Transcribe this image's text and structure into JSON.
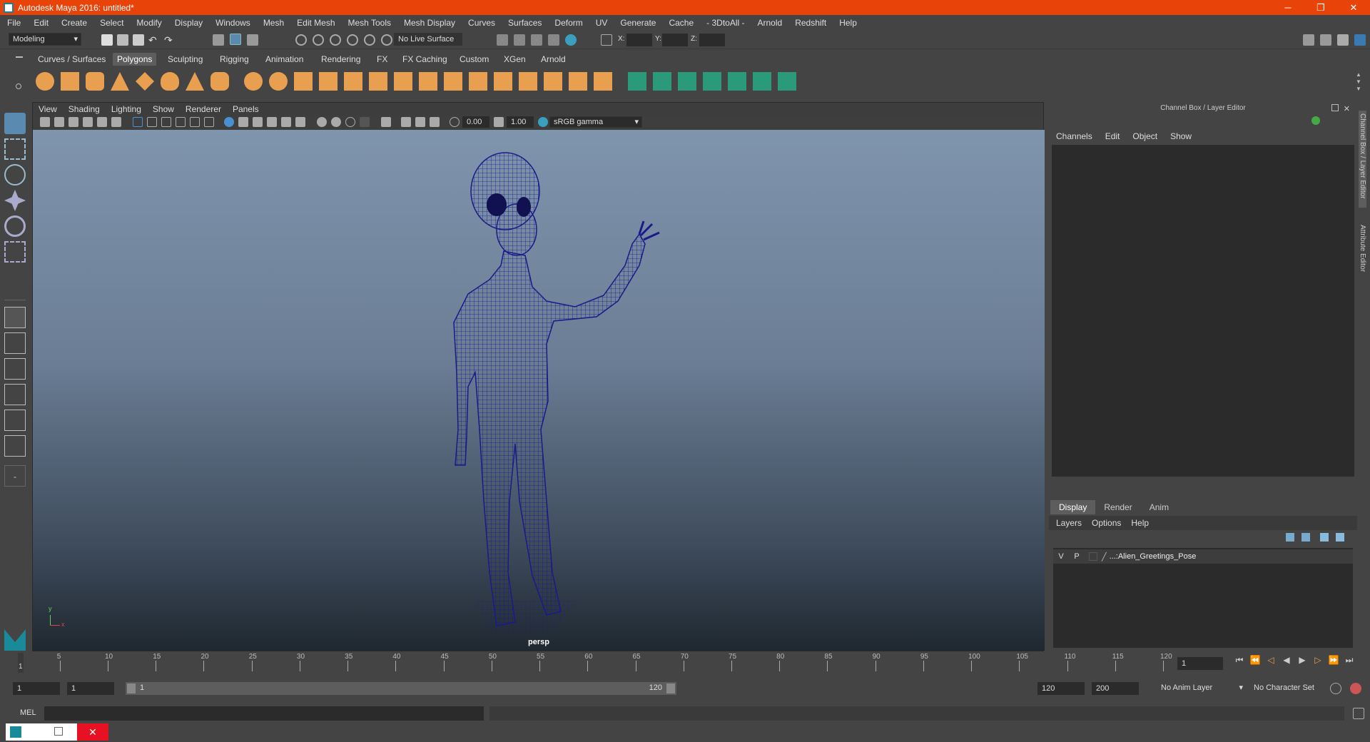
{
  "window": {
    "title": "Autodesk Maya 2016: untitled*",
    "minimize_icon": "minimize-icon",
    "restore_icon": "restore-icon",
    "close_icon": "close-icon"
  },
  "menu": [
    "File",
    "Edit",
    "Create",
    "Select",
    "Modify",
    "Display",
    "Windows",
    "Mesh",
    "Edit Mesh",
    "Mesh Tools",
    "Mesh Display",
    "Curves",
    "Surfaces",
    "Deform",
    "UV",
    "Generate",
    "Cache",
    "- 3DtoAll -",
    "Arnold",
    "Redshift",
    "Help"
  ],
  "status_line": {
    "menu_set": "Modeling",
    "live_surface": "No Live Surface",
    "x_label": "X:",
    "y_label": "Y:",
    "z_label": "Z:"
  },
  "shelf_tabs": [
    "Curves / Surfaces",
    "Polygons",
    "Sculpting",
    "Rigging",
    "Animation",
    "Rendering",
    "FX",
    "FX Caching",
    "Custom",
    "XGen",
    "Arnold"
  ],
  "shelf_active_tab": "Polygons",
  "viewport": {
    "menu": [
      "View",
      "Shading",
      "Lighting",
      "Show",
      "Renderer",
      "Panels"
    ],
    "exposure": "0.00",
    "gamma": "1.00",
    "color_space": "sRGB gamma",
    "camera_label": "persp",
    "axis_x": "x",
    "axis_y": "y"
  },
  "channel_box": {
    "title": "Channel Box / Layer Editor",
    "menu": [
      "Channels",
      "Edit",
      "Object",
      "Show"
    ]
  },
  "layer_editor": {
    "tabs": [
      "Display",
      "Render",
      "Anim"
    ],
    "active_tab": "Display",
    "menu": [
      "Layers",
      "Options",
      "Help"
    ],
    "layers": [
      {
        "v": "V",
        "p": "P",
        "name": "...:Alien_Greetings_Pose"
      }
    ]
  },
  "side_tabs": [
    "Channel Box / Layer Editor",
    "Attribute Editor"
  ],
  "timeline": {
    "ticks": [
      "1",
      "5",
      "10",
      "15",
      "20",
      "25",
      "30",
      "35",
      "40",
      "45",
      "50",
      "55",
      "60",
      "65",
      "70",
      "75",
      "80",
      "85",
      "90",
      "95",
      "100",
      "105",
      "110",
      "115",
      "120"
    ],
    "current_frame": "1",
    "current_frame_marker": "1"
  },
  "range": {
    "start": "1",
    "inner_start": "1",
    "slider_start": "1",
    "slider_end": "120",
    "inner_end": "120",
    "end": "200",
    "anim_layer": "No Anim Layer",
    "character_set": "No Character Set"
  },
  "command_line": {
    "label": "MEL"
  },
  "colors": {
    "titlebar": "#e8440a",
    "wireframe": "#1a1a8a",
    "shelf_icon": "#e8a050",
    "shelf_icon_green": "#2a9a7a"
  }
}
